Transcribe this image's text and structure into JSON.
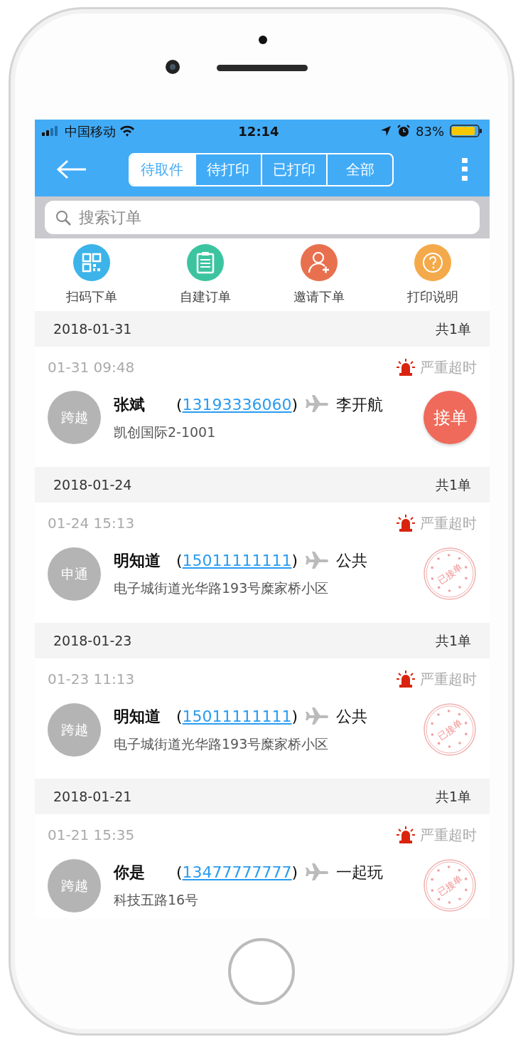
{
  "status_bar": {
    "carrier": "中国移动",
    "time": "12:14",
    "battery": "83%"
  },
  "tabs": [
    {
      "label": "待取件",
      "selected": true
    },
    {
      "label": "待打印",
      "selected": false
    },
    {
      "label": "已打印",
      "selected": false
    },
    {
      "label": "全部",
      "selected": false
    }
  ],
  "search": {
    "placeholder": "搜索订单"
  },
  "shortcuts": [
    {
      "label": "扫码下单",
      "color": "#3cb4ea"
    },
    {
      "label": "自建订单",
      "color": "#3cc4a0"
    },
    {
      "label": "邀请下单",
      "color": "#e8704f"
    },
    {
      "label": "打印说明",
      "color": "#f4aa4a"
    }
  ],
  "groups": [
    {
      "date": "2018-01-31",
      "count": "共1单",
      "orders": [
        {
          "time": "01-31 09:48",
          "alert": "严重超时",
          "courier": "跨越",
          "sender": "张斌",
          "open_paren": "(",
          "phone": "13193336060",
          "close_paren": ")",
          "receiver": "李开航",
          "address": "凯创国际2-1001",
          "kind": "button",
          "action": "接单"
        }
      ]
    },
    {
      "date": "2018-01-24",
      "count": "共1单",
      "orders": [
        {
          "time": "01-24 15:13",
          "alert": "严重超时",
          "courier": "申通",
          "sender": "明知道",
          "open_paren": "(",
          "phone": "15011111111",
          "close_paren": ")",
          "receiver": "公共",
          "address": "电子城街道光华路193号糜家桥小区",
          "kind": "stamp",
          "action": "已接单"
        }
      ]
    },
    {
      "date": "2018-01-23",
      "count": "共1单",
      "orders": [
        {
          "time": "01-23 11:13",
          "alert": "严重超时",
          "courier": "跨越",
          "sender": "明知道",
          "open_paren": "(",
          "phone": "15011111111",
          "close_paren": ")",
          "receiver": "公共",
          "address": "电子城街道光华路193号糜家桥小区",
          "kind": "stamp",
          "action": "已接单"
        }
      ]
    },
    {
      "date": "2018-01-21",
      "count": "共1单",
      "orders": [
        {
          "time": "01-21 15:35",
          "alert": "严重超时",
          "courier": "跨越",
          "sender": "你是",
          "open_paren": "(",
          "phone": "13477777777",
          "close_paren": ")",
          "receiver": "一起玩",
          "address": "科技五路16号",
          "kind": "stamp",
          "action": "已接单"
        }
      ]
    }
  ]
}
